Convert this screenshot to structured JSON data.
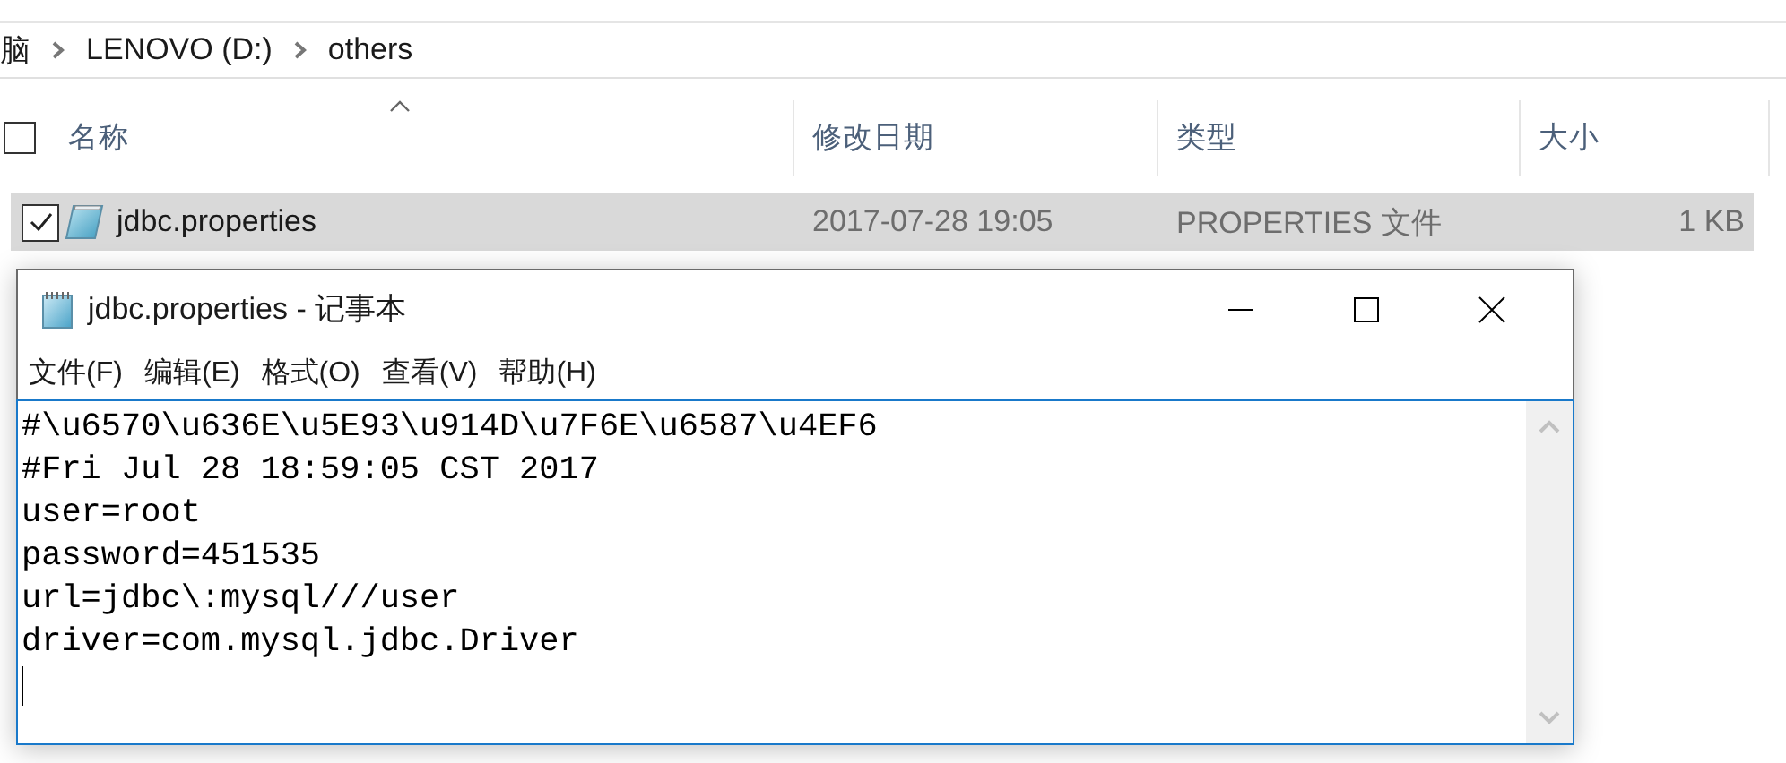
{
  "explorer": {
    "breadcrumb": [
      {
        "label": "脑"
      },
      {
        "label": "LENOVO (D:)"
      },
      {
        "label": "others"
      }
    ],
    "header_checkbox": {
      "checked": false
    },
    "columns": [
      "名称",
      "修改日期",
      "类型",
      "大小"
    ],
    "rows": [
      {
        "name": "jdbc.properties",
        "date": "2017-07-28 19:05",
        "type": "PROPERTIES 文件",
        "size": "1 KB",
        "selected": true,
        "checked": true
      }
    ]
  },
  "notepad": {
    "title": "jdbc.properties - 记事本",
    "menu": [
      "文件(F)",
      "编辑(E)",
      "格式(O)",
      "查看(V)",
      "帮助(H)"
    ],
    "lines": [
      "#\\u6570\\u636E\\u5E93\\u914D\\u7F6E\\u6587\\u4EF6",
      "#Fri Jul 28 18:59:05 CST 2017",
      "user=root",
      "password=451535",
      "url=jdbc\\:mysql///user",
      "driver=com.mysql.jdbc.Driver"
    ]
  }
}
